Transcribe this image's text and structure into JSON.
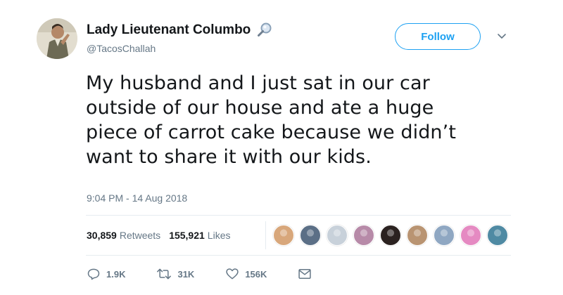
{
  "author": {
    "display_name": "Lady Lieutenant Columbo",
    "handle": "@TacosChallah",
    "badge_icon": "magnifying-glass-icon"
  },
  "follow_label": "Follow",
  "more_icon": "chevron-down-icon",
  "tweet": {
    "lines": [
      "My husband and I just sat in our car",
      "outside of our house and ate a huge",
      "piece of carrot cake because we didn’t",
      "want to share it with our kids."
    ],
    "timestamp": "9:04 PM - 14 Aug 2018"
  },
  "stats": {
    "retweets_count": "30,859",
    "retweets_label": "Retweets",
    "likes_count": "155,921",
    "likes_label": "Likes"
  },
  "likers": [
    {
      "color": "#d8a77b"
    },
    {
      "color": "#5b6f86"
    },
    {
      "color": "#c8d1da"
    },
    {
      "color": "#b78aa8"
    },
    {
      "color": "#2b2220"
    },
    {
      "color": "#b99472"
    },
    {
      "color": "#8fa7c2"
    },
    {
      "color": "#e58ac2"
    },
    {
      "color": "#4f8aa3"
    }
  ],
  "actions": {
    "reply_count": "1.9K",
    "retweet_count": "31K",
    "like_count": "156K"
  },
  "colors": {
    "accent": "#1da1f2",
    "text": "#14171a",
    "muted": "#657786"
  }
}
